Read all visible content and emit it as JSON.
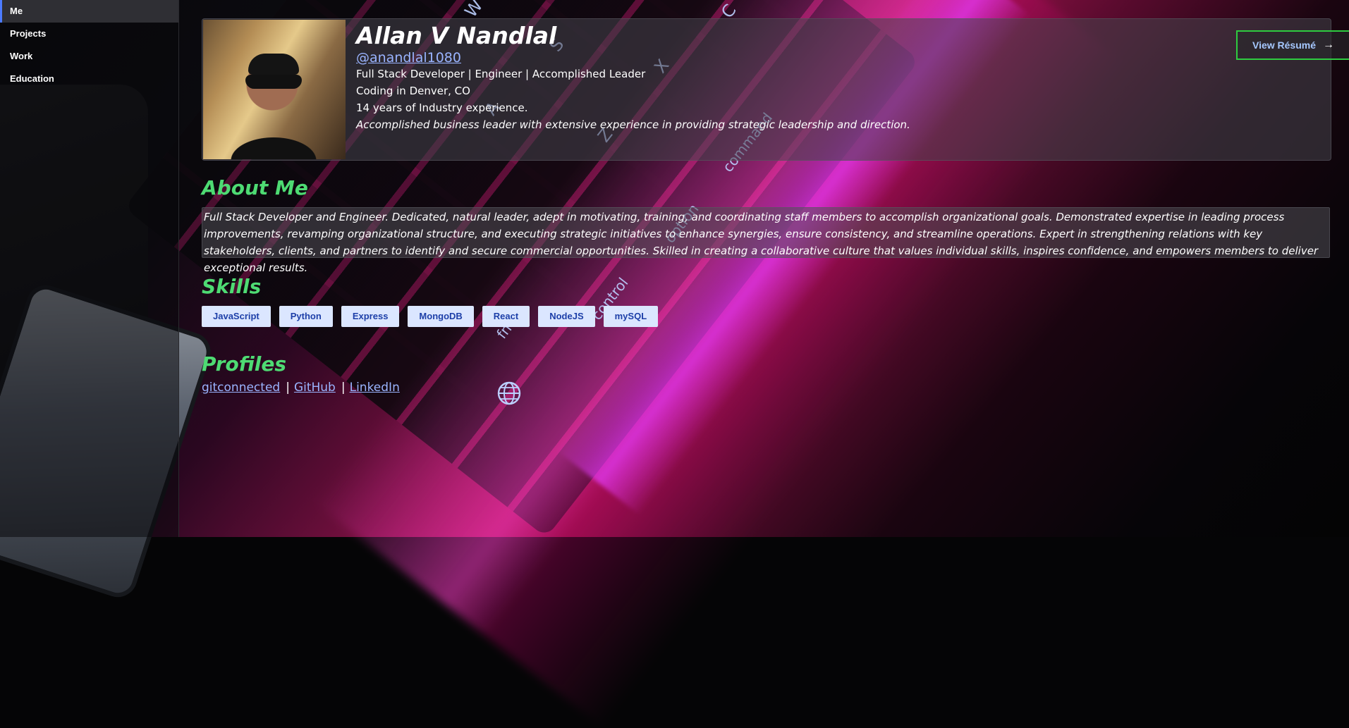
{
  "sidebar": {
    "items": [
      {
        "label": "Me",
        "active": true
      },
      {
        "label": "Projects",
        "active": false
      },
      {
        "label": "Work",
        "active": false
      },
      {
        "label": "Education",
        "active": false
      }
    ]
  },
  "profile": {
    "name": "Allan V Nandlal",
    "handle": "@anandlal1080",
    "headline": "Full Stack Developer | Engineer | Accomplished Leader",
    "location": "Coding in Denver, CO",
    "experience": "14 years of Industry experience.",
    "summary": "Accomplished business leader with extensive experience in providing strategic leadership and direction.",
    "resume_button": "View Résumé",
    "resume_arrow": "→"
  },
  "about": {
    "title": "About Me",
    "text": "Full Stack Developer and Engineer. Dedicated, natural leader, adept in motivating, training, and coordinating staff members to accomplish organizational goals. Demonstrated expertise in leading process improvements, revamping organizational structure, and executing strategic initiatives to enhance synergies, ensure consistency, and streamline operations.  Expert in strengthening relations with key stakeholders, clients, and partners to identify and secure commercial opportunities. Skilled in creating a collaborative culture that values individual skills, inspires confidence, and empowers members to deliver exceptional results."
  },
  "skills": {
    "title": "Skills",
    "items": [
      "JavaScript",
      "Python",
      "Express",
      "MongoDB",
      "React",
      "NodeJS",
      "mySQL"
    ]
  },
  "profiles": {
    "title": "Profiles",
    "links": [
      "gitconnected",
      "GitHub",
      "LinkedIn"
    ],
    "separator": "|"
  },
  "background": {
    "key_labels": [
      "W",
      "C",
      "S",
      "X",
      "A",
      "Z",
      "command",
      "option",
      "control",
      "fn"
    ],
    "colors": {
      "accent_green": "#4edb73",
      "link_blue": "#9ab4ff",
      "button_border": "#2ecc40",
      "skill_bg": "#dbe6ff"
    }
  }
}
